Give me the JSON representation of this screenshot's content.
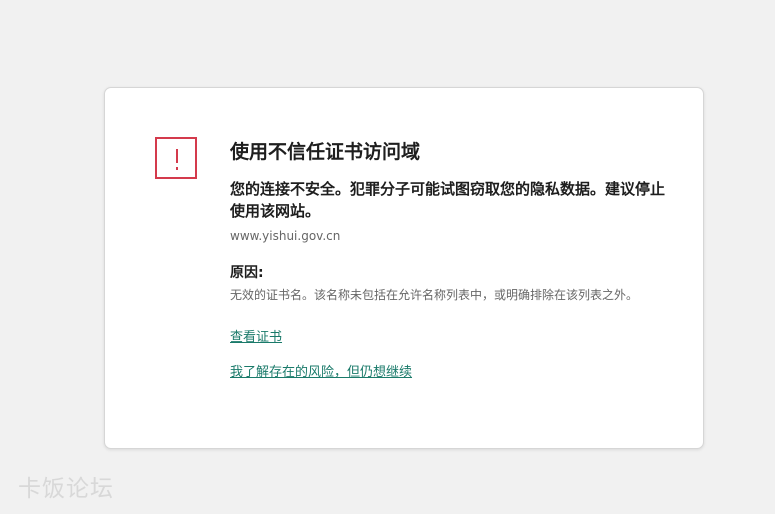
{
  "dialog": {
    "title": "使用不信任证书访问域",
    "warning": "您的连接不安全。犯罪分子可能试图窃取您的隐私数据。建议停止使用该网站。",
    "domain": "www.yishui.gov.cn",
    "reason_label": "原因:",
    "reason_text": "无效的证书名。该名称未包括在允许名称列表中，或明确排除在该列表之外。",
    "view_certificate": "查看证书",
    "accept_risk": "我了解存在的风险，但仍想继续"
  },
  "watermark": "卡饭论坛",
  "colors": {
    "alert": "#d43a4c",
    "link": "#1a7a6a",
    "background": "#f1f1f1"
  }
}
